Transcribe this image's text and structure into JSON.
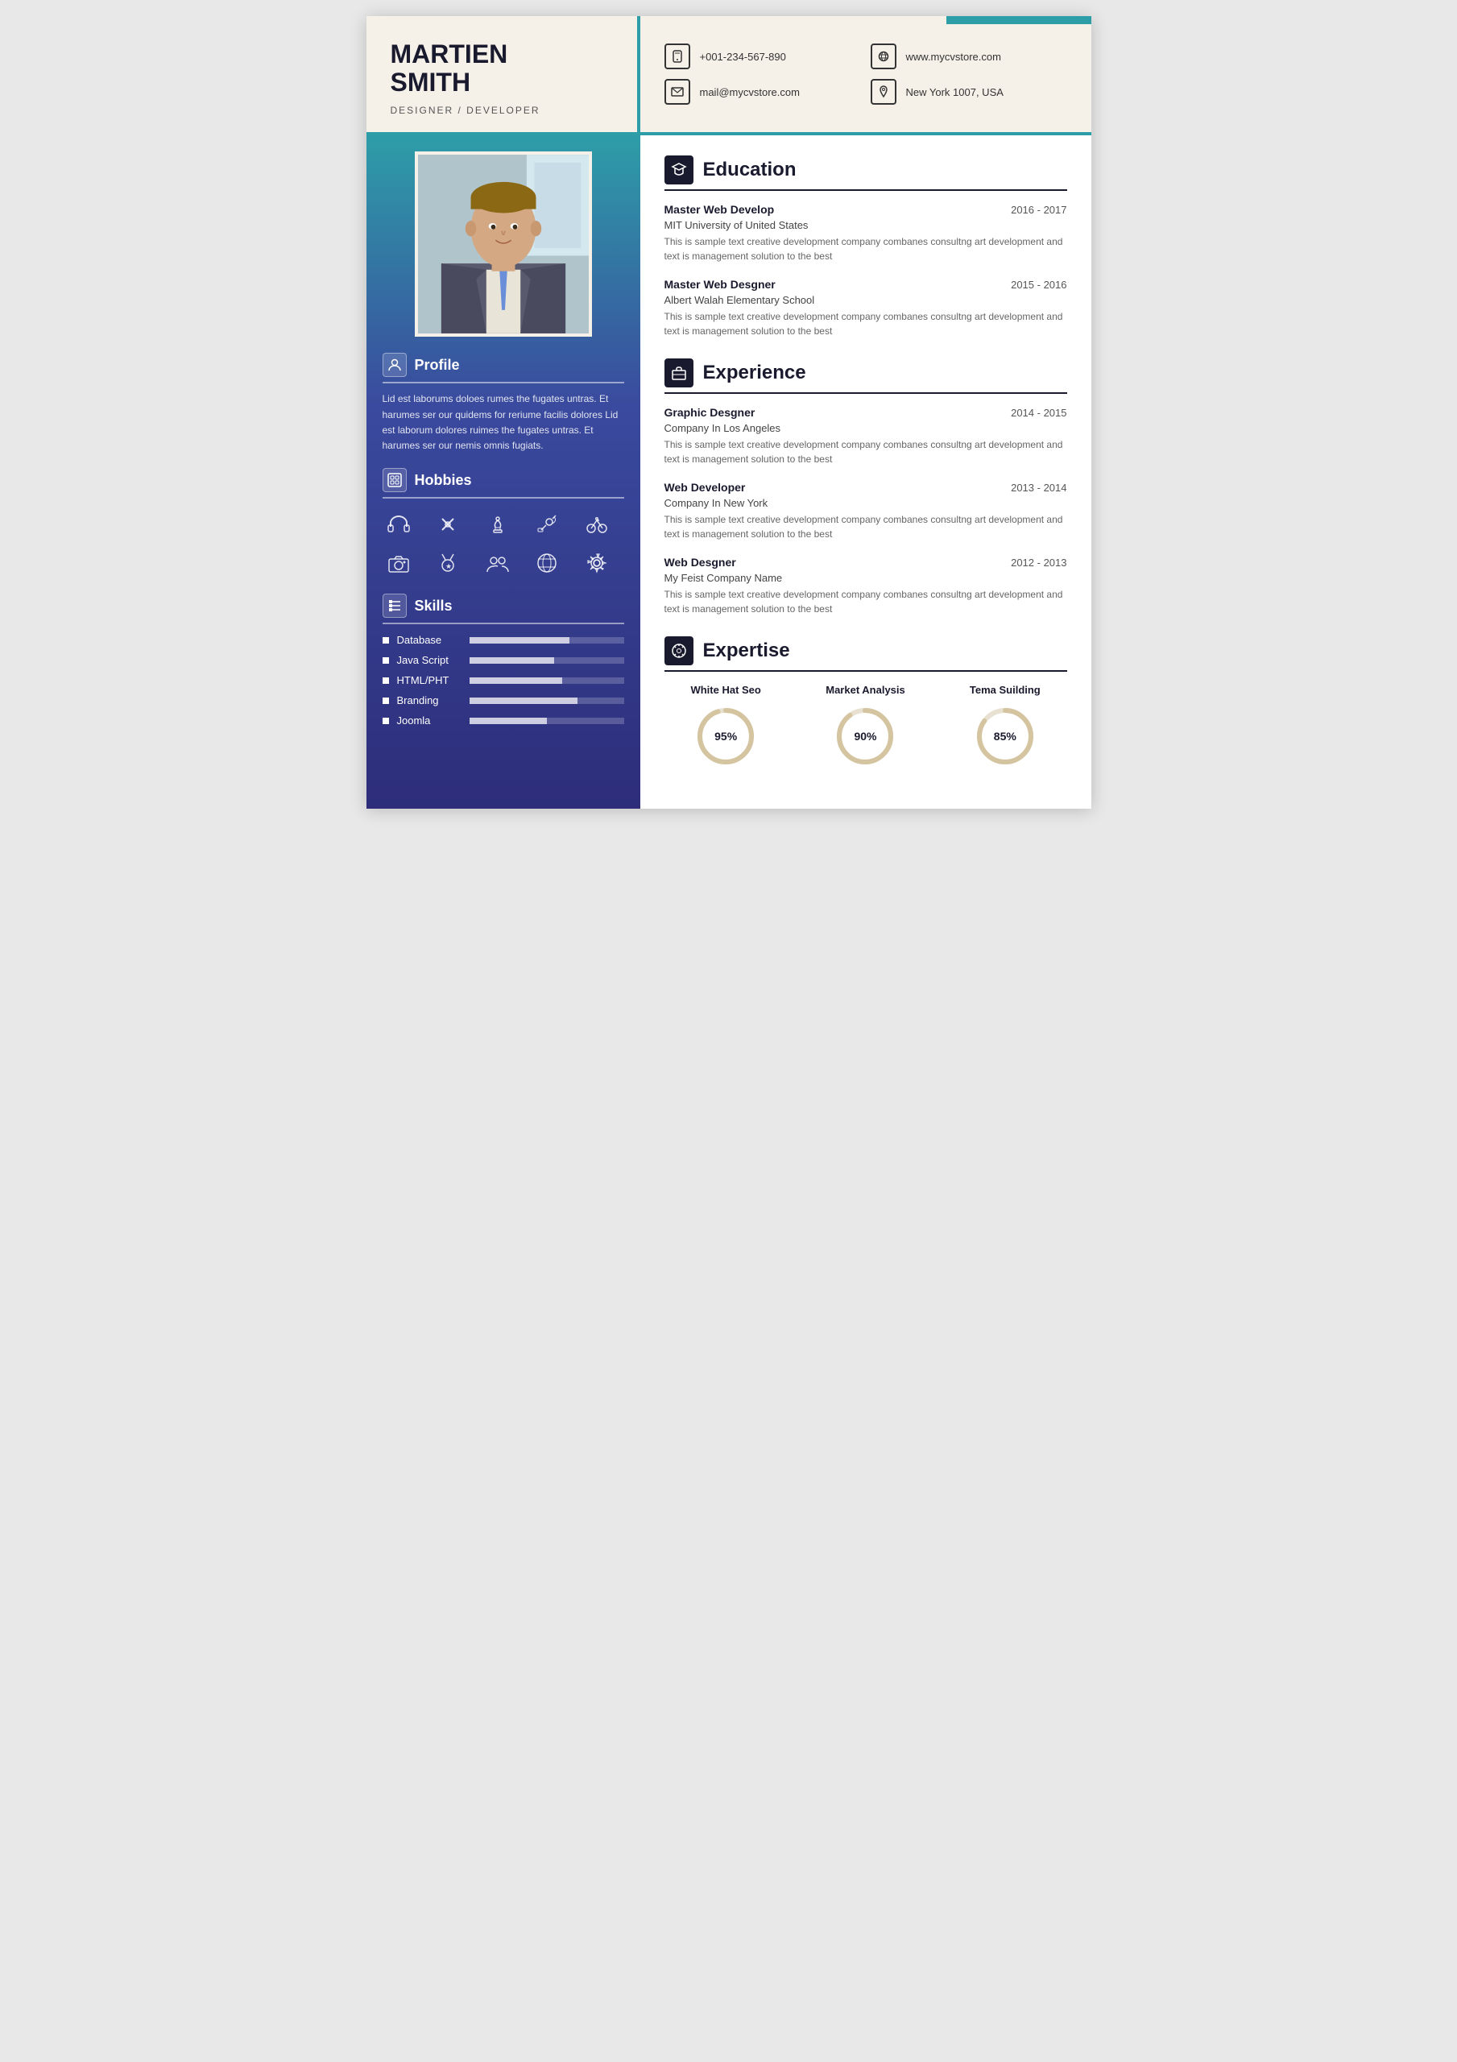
{
  "header": {
    "name": "MARTIEN\nSMITH",
    "title": "DESIGNER / DEVELOPER",
    "contact": [
      {
        "icon": "📞",
        "value": "+001-234-567-890"
      },
      {
        "icon": "🖱️",
        "value": "www.mycvstore.com"
      },
      {
        "icon": "✉️",
        "value": "mail@mycvstore.com"
      },
      {
        "icon": "📍",
        "value": "New York 1007, USA"
      }
    ]
  },
  "sidebar": {
    "profile_section": "Profile",
    "profile_text": "Lid est laborums doloes rumes the fugates untras. Et harumes ser our quidems for reriume facilis dolores Lid est laborum dolores ruimes the fugates untras. Et harumes ser our nemis omnis fugiats.",
    "hobbies_section": "Hobbies",
    "hobbies": [
      "🎧",
      "🎸",
      "♟️",
      "📡",
      "🚴",
      "📷",
      "🏅",
      "👥",
      "🌐",
      "⚙️"
    ],
    "skills_section": "Skills",
    "skills": [
      {
        "name": "Database",
        "pct": 65
      },
      {
        "name": "Java Script",
        "pct": 55
      },
      {
        "name": "HTML/PHT",
        "pct": 60
      },
      {
        "name": "Branding",
        "pct": 70
      },
      {
        "name": "Joomla",
        "pct": 50
      }
    ]
  },
  "education": {
    "section_title": "Education",
    "entries": [
      {
        "title": "Master Web Develop",
        "date": "2016 - 2017",
        "subtitle": "MIT University of United States",
        "desc": "This is sample text creative development company combanes consultng art development and text is management solution to the best"
      },
      {
        "title": "Master Web Desgner",
        "date": "2015 - 2016",
        "subtitle": "Albert Walah Elementary School",
        "desc": "This is sample text creative development company combanes consultng art development and text is management solution to the best"
      }
    ]
  },
  "experience": {
    "section_title": "Experience",
    "entries": [
      {
        "title": "Graphic Desgner",
        "date": "2014 - 2015",
        "subtitle": "Company In Los Angeles",
        "desc": "This is sample text creative development company combanes consultng art development and text is management solution to the best"
      },
      {
        "title": "Web Developer",
        "date": "2013 - 2014",
        "subtitle": "Company In New York",
        "desc": "This is sample text creative development company combanes consultng art development and text is management solution to the best"
      },
      {
        "title": "Web Desgner",
        "date": "2012 - 2013",
        "subtitle": "My Feist Company Name",
        "desc": "This is sample text creative development company combanes consultng art development and text is management solution to the best"
      }
    ]
  },
  "expertise": {
    "section_title": "Expertise",
    "items": [
      {
        "label": "White Hat Seo",
        "pct": 95
      },
      {
        "label": "Market Analysis",
        "pct": 90
      },
      {
        "label": "Tema Suilding",
        "pct": 85
      }
    ]
  }
}
